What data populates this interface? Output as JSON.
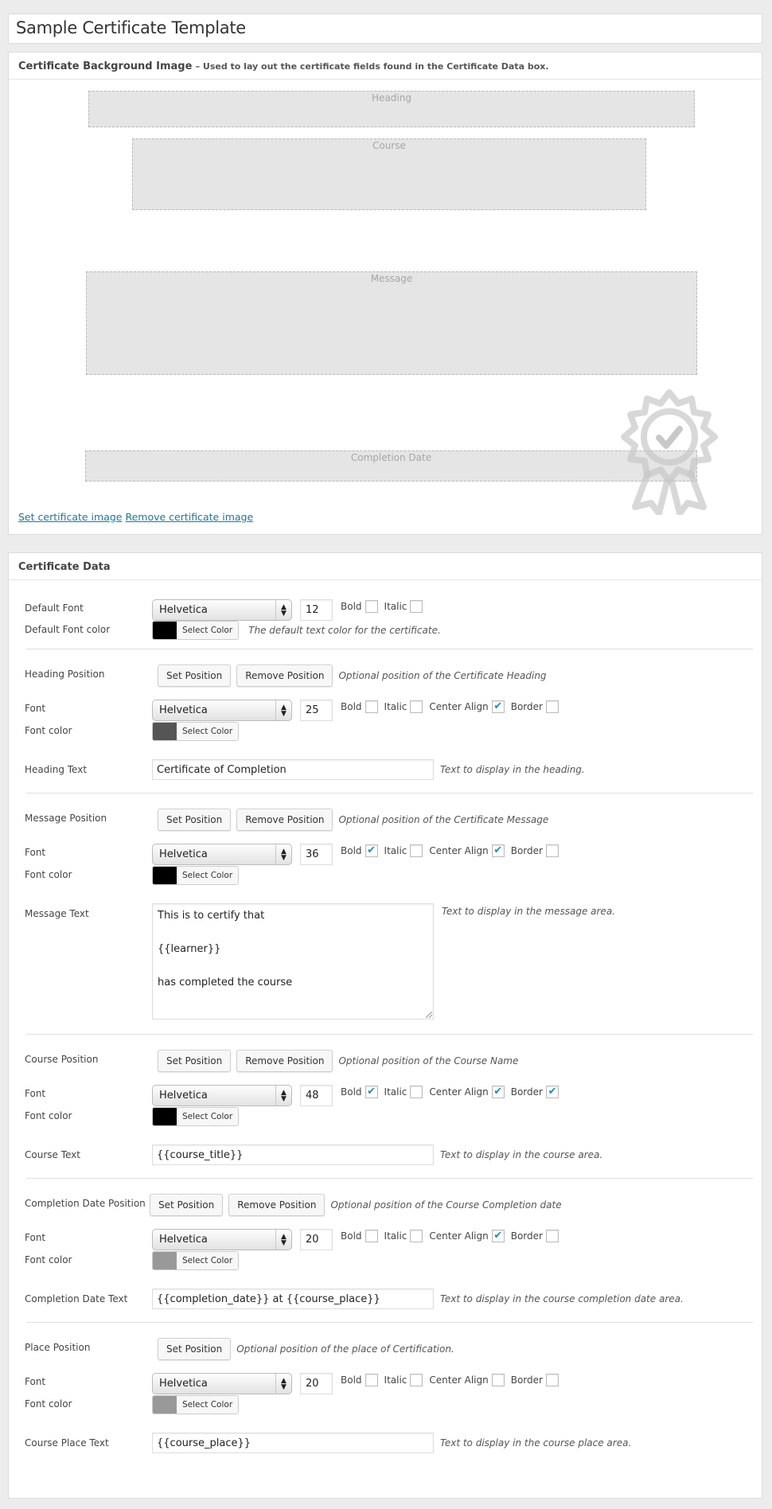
{
  "page": {
    "title": "Sample Certificate Template"
  },
  "background_box": {
    "title": "Certificate Background Image",
    "subtitle": "– Used to lay out the certificate fields found in the Certificate Data box.",
    "zones": [
      {
        "label": "Heading"
      },
      {
        "label": "Course"
      },
      {
        "label": "Message"
      },
      {
        "label": "Completion Date"
      }
    ],
    "badge_icon": "award-rosette-check-icon",
    "links": {
      "set": "Set certificate image",
      "remove": "Remove certificate image"
    }
  },
  "data_box": {
    "title": "Certificate Data",
    "buttons": {
      "set_position": "Set Position",
      "remove_position": "Remove Position",
      "select_color": "Select Color"
    },
    "option_labels": {
      "bold": "Bold",
      "italic": "Italic",
      "center": "Center Align",
      "border": "Border"
    },
    "default": {
      "font_label": "Default Font",
      "font": "Helvetica",
      "size": "12",
      "bold": false,
      "italic": false,
      "color_label": "Default Font color",
      "color": "#000000",
      "color_hint": "The default text color for the certificate."
    },
    "sections": [
      {
        "position_label": "Heading Position",
        "position_hint": "Optional position of the Certificate Heading",
        "has_remove": true,
        "font_label": "Font",
        "font": "Helvetica",
        "size": "25",
        "bold": false,
        "italic": false,
        "center": true,
        "border": false,
        "color_label": "Font color",
        "color": "#555555",
        "text_label": "Heading Text",
        "text": "Certificate of Completion",
        "text_hint": "Text to display in the heading."
      },
      {
        "position_label": "Message Position",
        "position_hint": "Optional position of the Certificate Message",
        "has_remove": true,
        "font_label": "Font",
        "font": "Helvetica",
        "size": "36",
        "bold": true,
        "italic": false,
        "center": true,
        "border": false,
        "color_label": "Font color",
        "color": "#000000",
        "text_label": "Message Text",
        "text": "This is to certify that\n\n{{learner}}\n\nhas completed the course",
        "text_hint": "Text to display in the message area."
      },
      {
        "position_label": "Course Position",
        "position_hint": "Optional position of the Course Name",
        "has_remove": true,
        "font_label": "Font",
        "font": "Helvetica",
        "size": "48",
        "bold": true,
        "italic": false,
        "center": true,
        "border": true,
        "color_label": "Font color",
        "color": "#000000",
        "text_label": "Course Text",
        "text": "{{course_title}}",
        "text_hint": "Text to display in the course area."
      },
      {
        "position_label": "Completion Date Position",
        "position_hint": "Optional position of the Course Completion date",
        "has_remove": true,
        "font_label": "Font",
        "font": "Helvetica",
        "size": "20",
        "bold": false,
        "italic": false,
        "center": true,
        "border": false,
        "color_label": "Font color",
        "color": "#999999",
        "text_label": "Completion Date Text",
        "text": "{{completion_date}} at {{course_place}}",
        "text_hint": "Text to display in the course completion date area."
      },
      {
        "position_label": "Place Position",
        "position_hint": "Optional position of the place of Certification.",
        "has_remove": false,
        "font_label": "Font",
        "font": "Helvetica",
        "size": "20",
        "bold": false,
        "italic": false,
        "center": false,
        "border": false,
        "color_label": "Font color",
        "color": "#999999",
        "text_label": "Course Place Text",
        "text": "{{course_place}}",
        "text_hint": "Text to display in the course place area."
      }
    ]
  }
}
